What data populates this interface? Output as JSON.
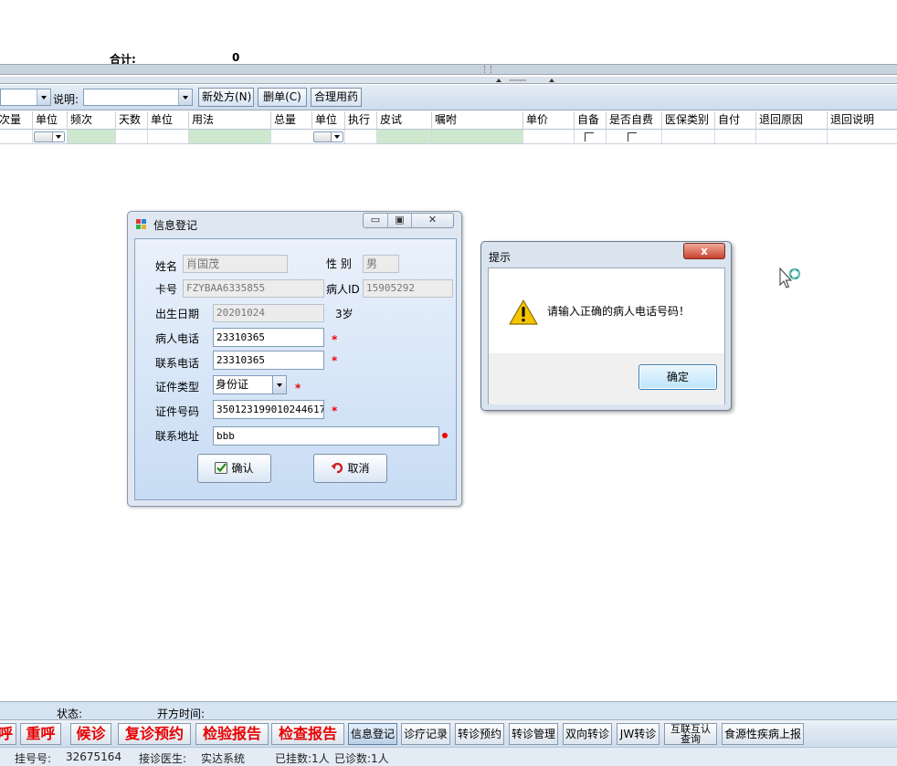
{
  "summary": {
    "total_label": "合计:",
    "total_value": "0"
  },
  "toolbar": {
    "desc_label": "说明:",
    "new_rx": "新处方(N)",
    "delete_rx": "删单(C)",
    "rational_drug": "合理用药"
  },
  "grid": {
    "columns": [
      "次量",
      "单位",
      "频次",
      "天数",
      "单位",
      "用法",
      "总量",
      "单位",
      "执行",
      "皮试",
      "嘱咐",
      "单价",
      "自备",
      "是否自费",
      "医保类别",
      "自付",
      "退回原因",
      "退回说明"
    ]
  },
  "info_dialog": {
    "title": "信息登记",
    "ctrl_min": "▭",
    "ctrl_max": "▣",
    "ctrl_close": "✕",
    "name_label": "姓名",
    "name_value": "肖国茂",
    "gender_label": "性 别",
    "gender_value": "男",
    "card_label": "卡号",
    "card_value": "FZYBAA6335855",
    "patient_id_label": "病人ID",
    "patient_id_value": "15905292",
    "birth_label": "出生日期",
    "birth_value": "20201024",
    "age_value": "3岁",
    "patient_phone_label": "病人电话",
    "patient_phone_value": "23310365",
    "contact_phone_label": "联系电话",
    "contact_phone_value": "23310365",
    "id_type_label": "证件类型",
    "id_type_value": "身份证",
    "id_number_label": "证件号码",
    "id_number_value": "350123199010244617",
    "address_label": "联系地址",
    "address_value": "bbb",
    "required_mark": "*",
    "confirm_label": "确认",
    "cancel_label": "取消"
  },
  "message_box": {
    "title": "提示",
    "close_glyph": "x",
    "message": "请输入正确的病人电话号码！",
    "ok_label": "确定"
  },
  "status": {
    "state_label": "状态:",
    "rx_time_label": "开方时间:"
  },
  "actions": {
    "big": [
      "呼",
      "重呼",
      "候诊",
      "复诊预约",
      "检验报告",
      "检查报告"
    ],
    "small": [
      "信息登记",
      "诊疗记录",
      "转诊预约",
      "转诊管理",
      "双向转诊",
      "JW转诊",
      "互联互认\n查询",
      "食源性疾病上报"
    ]
  },
  "footer": {
    "reg_no_label": "挂号号:",
    "reg_no_value": "32675164",
    "doctor_label": "接诊医生:",
    "doctor_value": "实达系统",
    "registered": "已挂数:1人",
    "treated": "已诊数:1人"
  },
  "colors": {
    "accent_red": "#e60000",
    "window_blue": "#c7dcf4",
    "grid_green": "#cde8cf"
  }
}
